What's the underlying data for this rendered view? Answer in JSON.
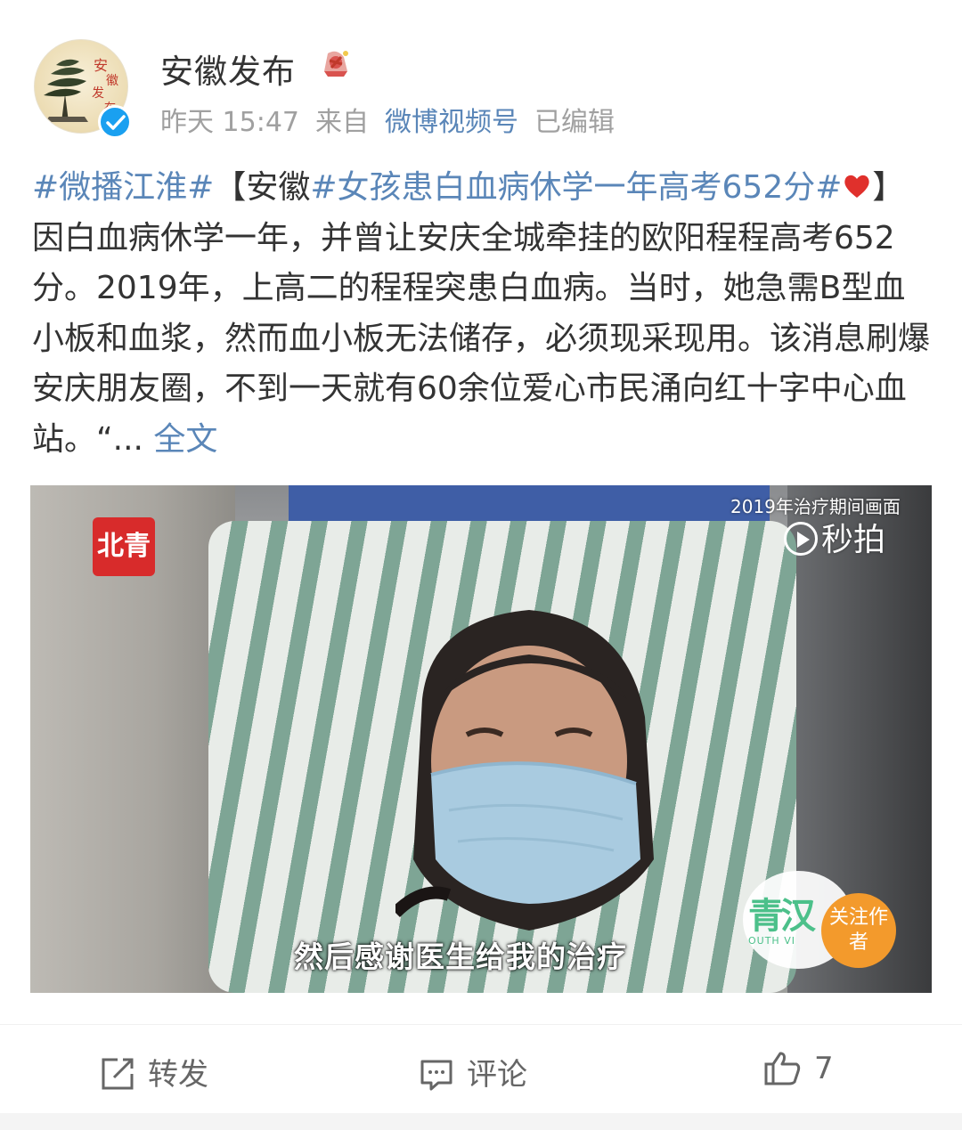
{
  "account": {
    "name": "安徽发布",
    "time": "昨天 15:47",
    "source_prefix": "来自",
    "source": "微博视频号",
    "edited": "已编辑",
    "avatar_text": "安徽发布"
  },
  "post": {
    "tag1": "#微播江淮#",
    "bracket_open": "【安徽",
    "tag2": "#女孩患白血病休学一年高考652分#",
    "bracket_close": "】",
    "body": "因白血病休学一年，并曾让安庆全城牵挂的欧阳程程高考652分。2019年，上高二的程程突患白血病。当时，她急需B型血小板和血浆，然而血小板无法储存，必须现采现用。该消息刷爆安庆朋友圈，不到一天就有60余位爱心市民涌向红十字中心血站。“...",
    "more": " 全文"
  },
  "video": {
    "top_caption": "2019年治疗期间画面",
    "watermark": "秒拍",
    "logo_left": "北青",
    "subtitle": "然后感谢医生给我的治疗",
    "brand_main": "青汉",
    "brand_sub": "OUTH VI",
    "follow_label": "关注作者"
  },
  "actions": {
    "repost": "转发",
    "comment": "评论",
    "like_count": "7"
  },
  "colors": {
    "link": "#5a86b8",
    "verified": "#1aa0f0",
    "follow": "#f39a2c"
  }
}
